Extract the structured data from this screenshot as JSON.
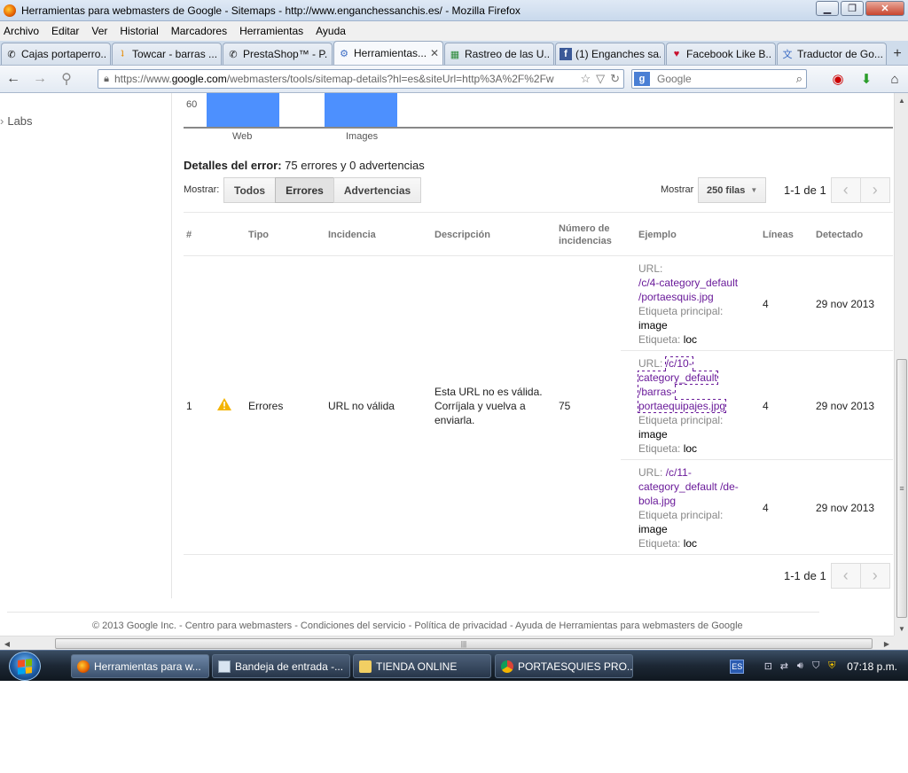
{
  "window": {
    "title": "Herramientas para webmasters de Google - Sitemaps - http://www.enganchessanchis.es/ - Mozilla Firefox"
  },
  "menubar": [
    "Archivo",
    "Editar",
    "Ver",
    "Historial",
    "Marcadores",
    "Herramientas",
    "Ayuda"
  ],
  "tabs": [
    {
      "label": "Cajas portaperro...",
      "icon": "phone-icon"
    },
    {
      "label": "Towcar - barras ...",
      "icon": "towcar-icon"
    },
    {
      "label": "PrestaShop™ - P...",
      "icon": "phone-icon"
    },
    {
      "label": "Herramientas...",
      "icon": "webmaster-tools-icon",
      "active": true
    },
    {
      "label": "Rastreo de las U...",
      "icon": "google-icon"
    },
    {
      "label": "(1) Enganches sa...",
      "icon": "facebook-icon"
    },
    {
      "label": "Facebook Like B...",
      "icon": "heart-icon"
    },
    {
      "label": "Traductor de Go...",
      "icon": "translate-icon"
    }
  ],
  "nav": {
    "url_prefix": "https://www.",
    "url_host": "google.com",
    "url_rest": "/webmasters/tools/sitemap-details?hl=es&siteUrl=http%3A%2F%2Fw",
    "search_placeholder": "Google"
  },
  "leftnav": {
    "labs": "Labs"
  },
  "chart_data": {
    "type": "bar",
    "categories": [
      "Web",
      "Images"
    ],
    "yticks": [
      "60"
    ]
  },
  "errors": {
    "heading_bold": "Detalles del error:",
    "heading_rest": "75 errores y 0 advertencias",
    "show_label": "Mostrar:",
    "filters": [
      "Todos",
      "Errores",
      "Advertencias"
    ],
    "rows_label": "Mostrar",
    "rows_value": "250 filas",
    "pager_top": "1-1 de 1",
    "pager_bottom": "1-1 de 1",
    "columns": [
      "#",
      "Tipo",
      "Incidencia",
      "Descripción",
      "Número de incidencias",
      "Ejemplo",
      "Líneas",
      "Detectado"
    ],
    "row": {
      "num": "1",
      "type": "Errores",
      "issue": "URL no válida",
      "description": "Esta URL no es válida. Corríjala y vuelva a enviarla.",
      "count": "75"
    },
    "examples": [
      {
        "url_label": "URL:",
        "url": "/c/4-category_default /portaesquis.jpg",
        "main_label": "Etiqueta principal:",
        "main_value": "image",
        "tag_label": "Etiqueta:",
        "tag_value": "loc",
        "lines": "4",
        "detected": "29 nov 2013"
      },
      {
        "url_label": "URL:",
        "url": "/c/10-category_default /barras-portaequipajes.jpg",
        "main_label": "Etiqueta principal:",
        "main_value": "image",
        "tag_label": "Etiqueta:",
        "tag_value": "loc",
        "lines": "4",
        "detected": "29 nov 2013"
      },
      {
        "url_label": "URL:",
        "url": "/c/11-category_default /de-bola.jpg",
        "main_label": "Etiqueta principal:",
        "main_value": "image",
        "tag_label": "Etiqueta:",
        "tag_value": "loc",
        "lines": "4",
        "detected": "29 nov 2013"
      }
    ]
  },
  "footer": "© 2013 Google Inc. - Centro para webmasters - Condiciones del servicio - Política de privacidad - Ayuda de Herramientas para webmasters de Google",
  "taskbar": {
    "items": [
      {
        "label": "Herramientas para w...",
        "icon": "firefox-icon",
        "active": true
      },
      {
        "label": "Bandeja de entrada -...",
        "icon": "mail-icon"
      },
      {
        "label": "TIENDA ONLINE",
        "icon": "folder-icon"
      },
      {
        "label": "PORTAESQUIES PRO...",
        "icon": "chrome-icon"
      }
    ],
    "lang": "ES",
    "clock": "07:18 p.m."
  },
  "colors": {
    "bar": "#4d90fe",
    "link_visited": "#6a1b9a"
  }
}
